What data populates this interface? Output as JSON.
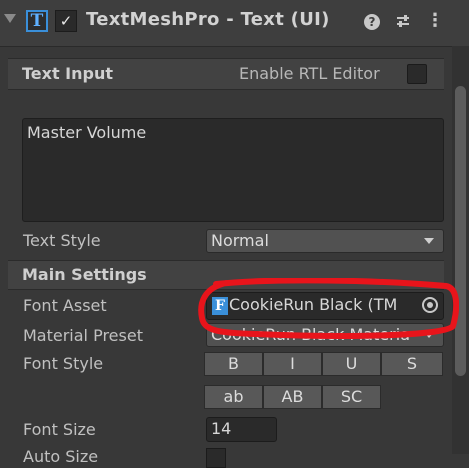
{
  "header": {
    "title": "TextMeshPro - Text (UI)",
    "enabled_check": "✓",
    "component_icon_letter": "T"
  },
  "text_input": {
    "section_label": "Text Input",
    "rtl_label": "Enable RTL Editor",
    "text_value": "Master Volume"
  },
  "text_style": {
    "label": "Text Style",
    "value": "Normal"
  },
  "main_settings": {
    "section_label": "Main Settings",
    "font_asset_label": "Font Asset",
    "font_asset_value": "CookieRun Black (TM",
    "font_asset_icon_letter": "F",
    "material_preset_label": "Material Preset",
    "material_preset_value": "CookieRun Black Material",
    "font_style_label": "Font Style",
    "font_style_row1": [
      "B",
      "I",
      "U",
      "S"
    ],
    "font_style_row2": [
      "ab",
      "AB",
      "SC"
    ],
    "font_size_label": "Font Size",
    "font_size_value": "14",
    "auto_size_label": "Auto Size"
  },
  "colors": {
    "panel_bg": "#383838",
    "accent_blue": "#3a8fd9",
    "annotation_red": "#e8141b"
  }
}
